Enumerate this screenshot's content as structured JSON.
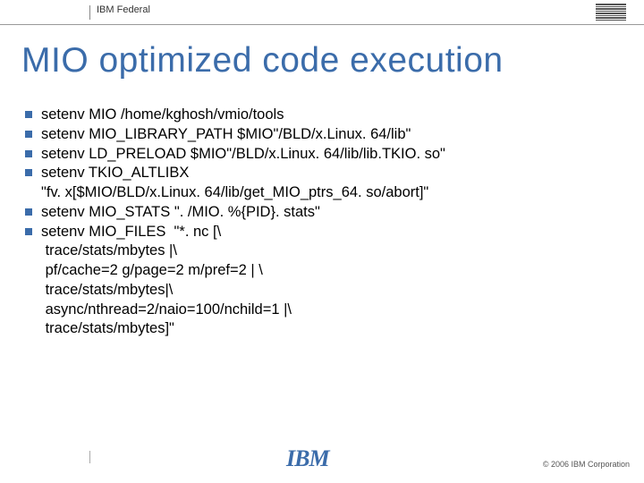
{
  "header": {
    "label": "IBM Federal"
  },
  "title": "MIO optimized code execution",
  "bullets": [
    "setenv MIO /home/kghosh/vmio/tools",
    "setenv MIO_LIBRARY_PATH $MIO\"/BLD/x.Linux. 64/lib\"",
    "setenv LD_PRELOAD $MIO\"/BLD/x.Linux. 64/lib/lib.TKIO. so\"",
    "setenv TKIO_ALTLIBX\n\"fv. x[$MIO/BLD/x.Linux. 64/lib/get_MIO_ptrs_64. so/abort]\"",
    "setenv MIO_STATS \". /MIO. %{PID}. stats\"",
    "setenv MIO_FILES  \"*. nc [\\\n trace/stats/mbytes |\\\n pf/cache=2 g/page=2 m/pref=2 | \\\n trace/stats/mbytes|\\\n async/nthread=2/naio=100/nchild=1 |\\\n trace/stats/mbytes]\""
  ],
  "footer": {
    "logo": "IBM",
    "copyright": "© 2006 IBM Corporation"
  }
}
